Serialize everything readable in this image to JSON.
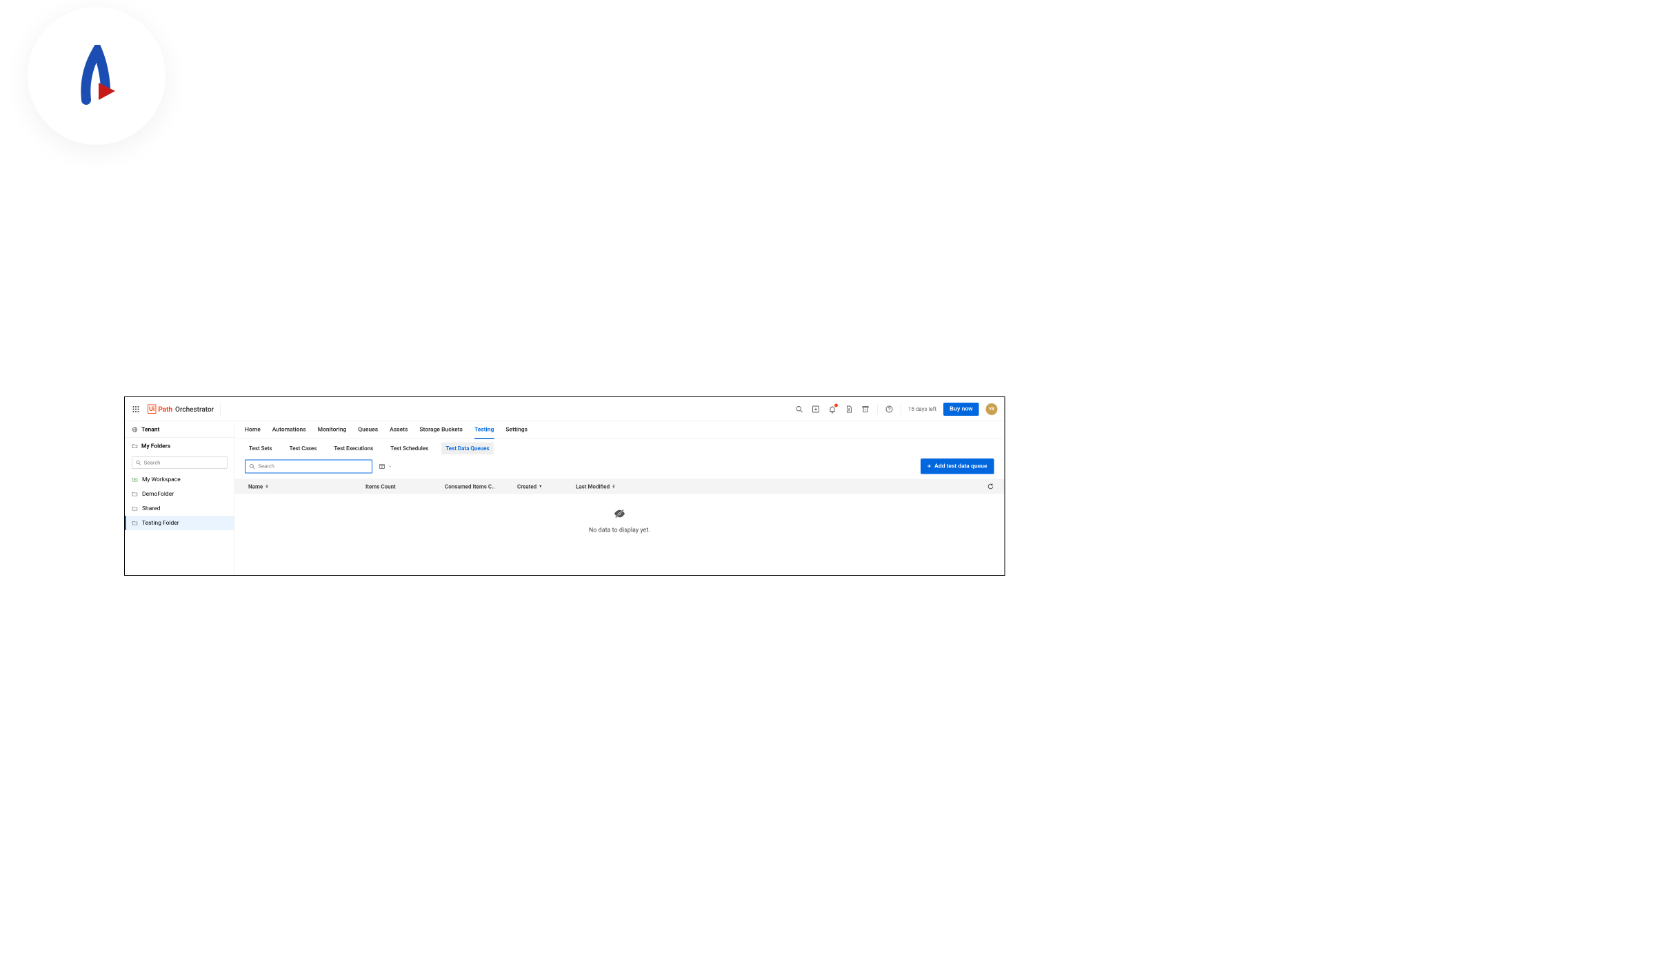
{
  "corner_logo": {
    "name": "ar-logo"
  },
  "header": {
    "brand_ui": "Ui",
    "brand_path": "Path",
    "brand_tm": "™",
    "product": "Orchestrator",
    "days_left": "15 days left",
    "buy_label": "Buy now",
    "avatar_initials": "YB"
  },
  "sidebar": {
    "tenant_label": "Tenant",
    "folders_label": "My Folders",
    "search_placeholder": "Search",
    "folders": [
      {
        "label": "My Workspace",
        "workspace": true
      },
      {
        "label": "DemoFolder"
      },
      {
        "label": "Shared"
      },
      {
        "label": "Testing Folder"
      }
    ]
  },
  "tabs": [
    {
      "label": "Home"
    },
    {
      "label": "Automations"
    },
    {
      "label": "Monitoring"
    },
    {
      "label": "Queues"
    },
    {
      "label": "Assets"
    },
    {
      "label": "Storage Buckets"
    },
    {
      "label": "Testing",
      "active": true
    },
    {
      "label": "Settings"
    }
  ],
  "subtabs": [
    {
      "label": "Test Sets"
    },
    {
      "label": "Test Cases"
    },
    {
      "label": "Test Executions"
    },
    {
      "label": "Test Schedules"
    },
    {
      "label": "Test Data Queues",
      "active": true
    }
  ],
  "toolbar": {
    "search_placeholder": "Search",
    "add_button_label": "Add test data queue"
  },
  "table": {
    "columns": {
      "name": "Name",
      "items_count": "Items Count",
      "consumed": "Consumed Items C..",
      "created": "Created",
      "last_modified": "Last Modified"
    }
  },
  "empty_state": {
    "text": "No data to display yet."
  }
}
